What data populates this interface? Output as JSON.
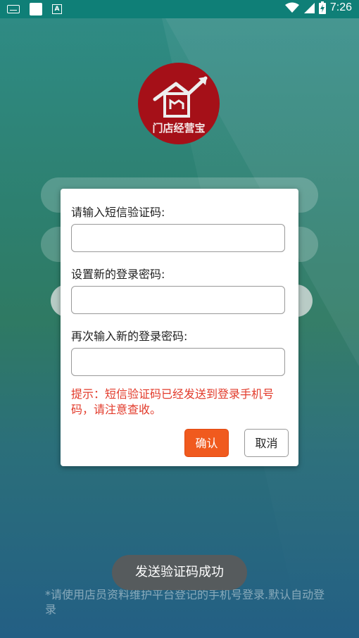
{
  "statusbar": {
    "time": "7:26",
    "icons": [
      "keyboard-icon",
      "app-square-icon",
      "a-notification-icon",
      "wifi-icon",
      "signal-icon",
      "battery-icon"
    ]
  },
  "app": {
    "logo_text": "门店经营宝",
    "brand_color": "#a51018"
  },
  "dialog": {
    "sms_label": "请输入短信验证码:",
    "new_password_label": "设置新的登录密码:",
    "confirm_password_label": "再次输入新的登录密码:",
    "sms_value": "",
    "new_password_value": "",
    "confirm_password_value": "",
    "hint": "提示：短信验证码已经发送到登录手机号码，请注意查收。",
    "confirm_button": "确认",
    "cancel_button": "取消",
    "accent_color": "#f05a1e",
    "hint_color": "#e23a2a"
  },
  "toast": {
    "message": "发送验证码成功"
  },
  "footer": {
    "note": "*请使用店员资料维护平台登记的手机号登录.默认自动登录"
  }
}
